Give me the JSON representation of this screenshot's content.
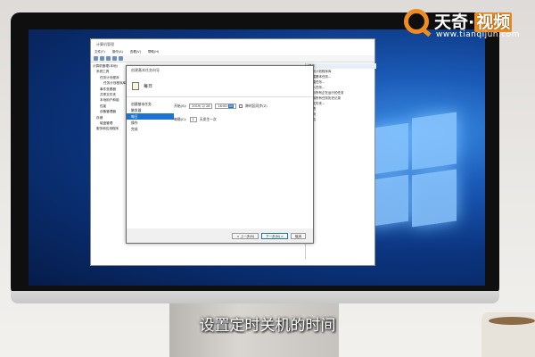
{
  "logo": {
    "brand": "天奇",
    "accent": "视频",
    "separator": "·",
    "url": "www.tianqijun.com",
    "color": "#f08c1f"
  },
  "subtitle": "设置定时关机的时间",
  "cm_window": {
    "title": "计算机管理",
    "menu": [
      "文件(F)",
      "操作(A)",
      "查看(V)",
      "帮助(H)"
    ],
    "tree": [
      "计算机管理(本地)",
      "系统工具",
      "任务计划程序",
      "任务计划程序库",
      "事件查看器",
      "共享文件夹",
      "本地用户和组",
      "性能",
      "设备管理器",
      "存储",
      "磁盘管理",
      "服务和应用程序"
    ],
    "actions_header": "操作",
    "actions": [
      "任务计划程序库",
      "创建基本任务...",
      "创建任务...",
      "导入任务...",
      "显示所有正在运行的任务",
      "启用所有任务历史记录",
      "新文件夹...",
      "查看",
      "刷新",
      "帮助"
    ]
  },
  "wizard": {
    "title": "创建基本任务向导",
    "header": "每日",
    "steps": [
      "创建基本任务",
      "触发器",
      "每日",
      "操作",
      "完成"
    ],
    "active_step": 2,
    "start_label": "开始(S):",
    "start_date": "2019/ 2/ 28",
    "start_time_hm": "16:00:",
    "start_time_s": "00",
    "sync_label": "跨时区同步(Z)",
    "recur_label": "每隔(C):",
    "recur_value": "1",
    "recur_unit": "天发生一次",
    "buttons": {
      "back": "< 上一步(B)",
      "next": "下一步(N) >",
      "cancel": "取消"
    },
    "highlight_color": "#1c73d0"
  }
}
